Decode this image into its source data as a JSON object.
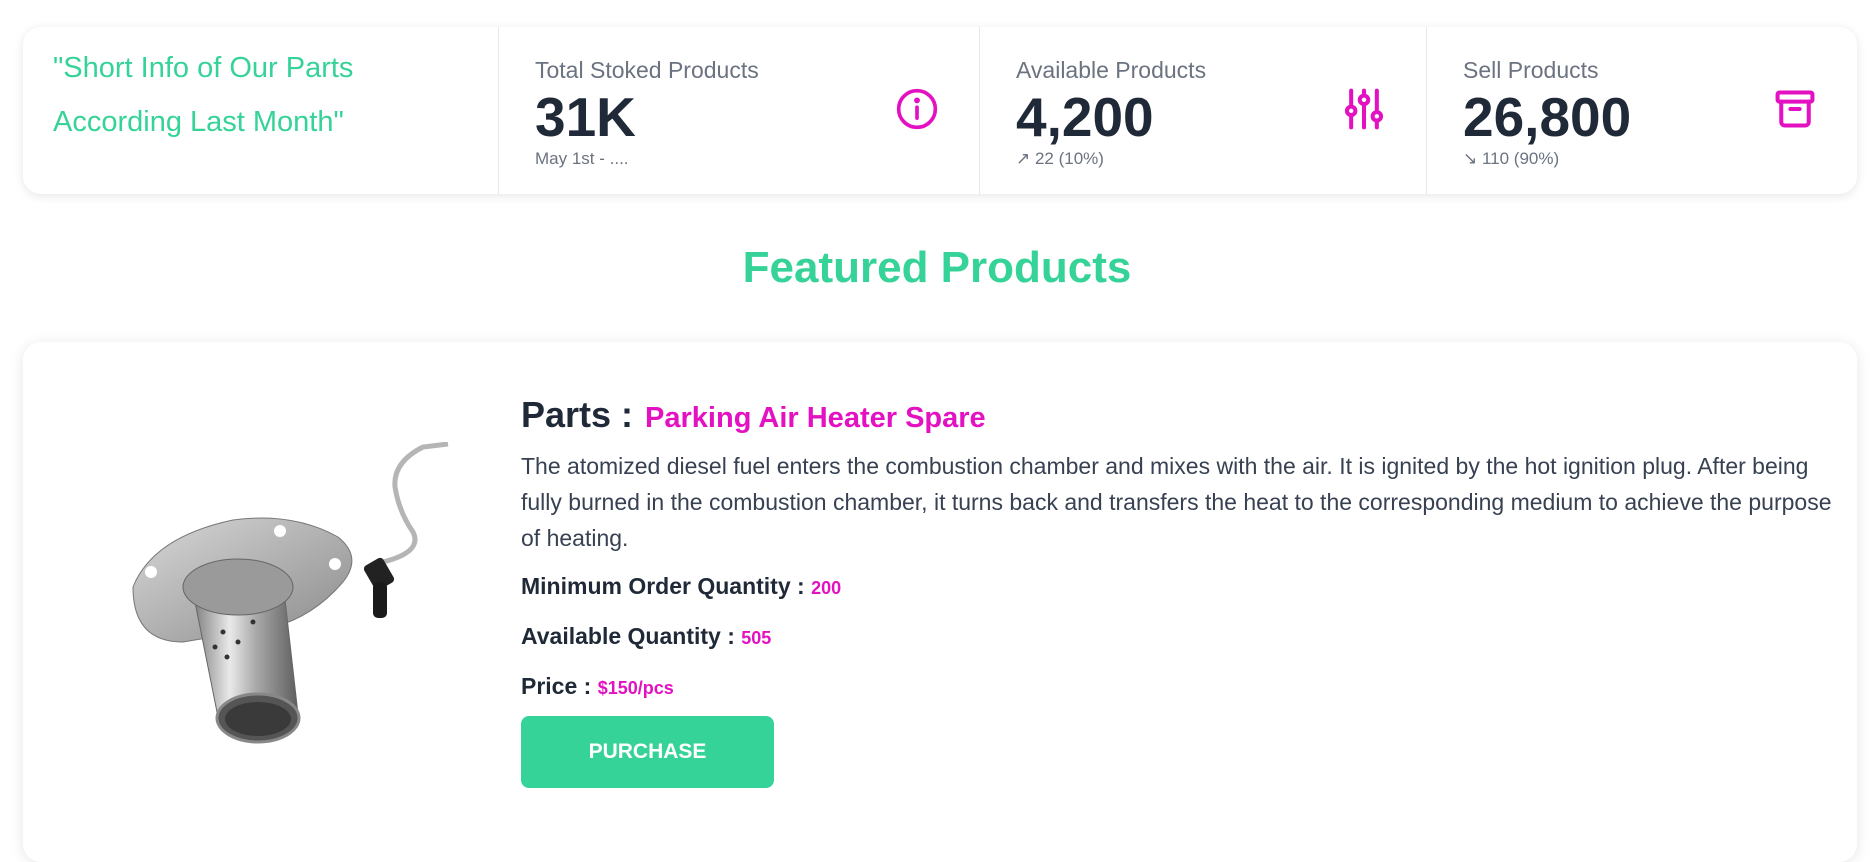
{
  "intro": {
    "line1": "\"Short Info of Our Parts",
    "line2": "According Last Month\""
  },
  "stats": [
    {
      "title": "Total Stoked Products",
      "value": "31K",
      "desc": "May 1st - ....",
      "icon": "info-circle-icon"
    },
    {
      "title": "Available Products",
      "value": "4,200",
      "desc": "↗ 22 (10%)",
      "icon": "sliders-icon"
    },
    {
      "title": "Sell Products",
      "value": "26,800",
      "desc": "↘ 110 (90%)",
      "icon": "archive-box-icon"
    }
  ],
  "featured": {
    "title": "Featured Products"
  },
  "product": {
    "parts_label": "Parts :",
    "name": "Parking Air Heater Spare",
    "description": "The atomized diesel fuel enters the combustion chamber and mixes with the air. It is ignited by the hot ignition plug. After being fully burned in the combustion chamber, it turns back and transfers the heat to the corresponding medium to achieve the purpose of heating.",
    "min_order_label": "Minimum Order Quantity :",
    "min_order_value": "200",
    "available_label": "Available Quantity :",
    "available_value": "505",
    "price_label": "Price :",
    "price_value": "$150/pcs",
    "purchase_label": "PURCHASE"
  },
  "colors": {
    "accent_green": "#36d399",
    "accent_magenta": "#e311c1",
    "text_dark": "#1f2937"
  }
}
